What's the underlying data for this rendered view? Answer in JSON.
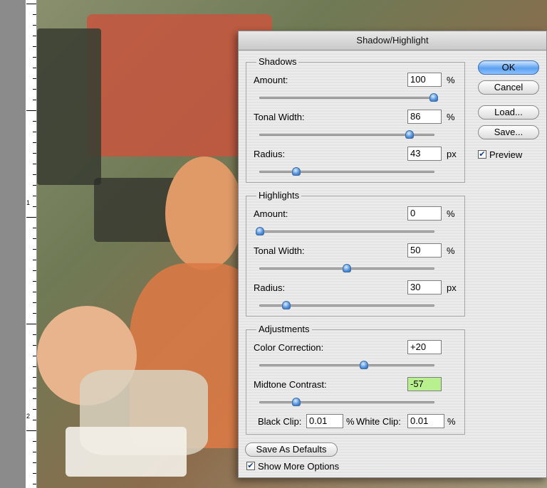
{
  "dialog": {
    "title": "Shadow/Highlight"
  },
  "shadows": {
    "title": "Shadows",
    "amount": {
      "label": "Amount:",
      "value": "100",
      "unit": "%",
      "slider": 1.0
    },
    "tonal_width": {
      "label": "Tonal Width:",
      "value": "86",
      "unit": "%",
      "slider": 0.86
    },
    "radius": {
      "label": "Radius:",
      "value": "43",
      "unit": "px",
      "slider": 0.21
    }
  },
  "highlights": {
    "title": "Highlights",
    "amount": {
      "label": "Amount:",
      "value": "0",
      "unit": "%",
      "slider": 0.0
    },
    "tonal_width": {
      "label": "Tonal Width:",
      "value": "50",
      "unit": "%",
      "slider": 0.5
    },
    "radius": {
      "label": "Radius:",
      "value": "30",
      "unit": "px",
      "slider": 0.15
    }
  },
  "adjustments": {
    "title": "Adjustments",
    "color_correction": {
      "label": "Color Correction:",
      "value": "+20",
      "slider": 0.6
    },
    "midtone_contrast": {
      "label": "Midtone Contrast:",
      "value": "-57",
      "slider": 0.21
    },
    "black_clip": {
      "label": "Black Clip:",
      "value": "0.01",
      "unit": "%"
    },
    "white_clip": {
      "label": "White Clip:",
      "value": "0.01",
      "unit": "%"
    }
  },
  "buttons": {
    "ok": "OK",
    "cancel": "Cancel",
    "load": "Load...",
    "save": "Save...",
    "save_defaults": "Save As Defaults"
  },
  "checkboxes": {
    "preview": {
      "label": "Preview",
      "checked": true
    },
    "more_options": {
      "label": "Show More Options",
      "checked": true
    }
  },
  "ruler": {
    "labels": [
      "1",
      "2"
    ]
  },
  "colors": {
    "accent": "#5ba1f0",
    "highlight_field": "#b8f08f"
  }
}
